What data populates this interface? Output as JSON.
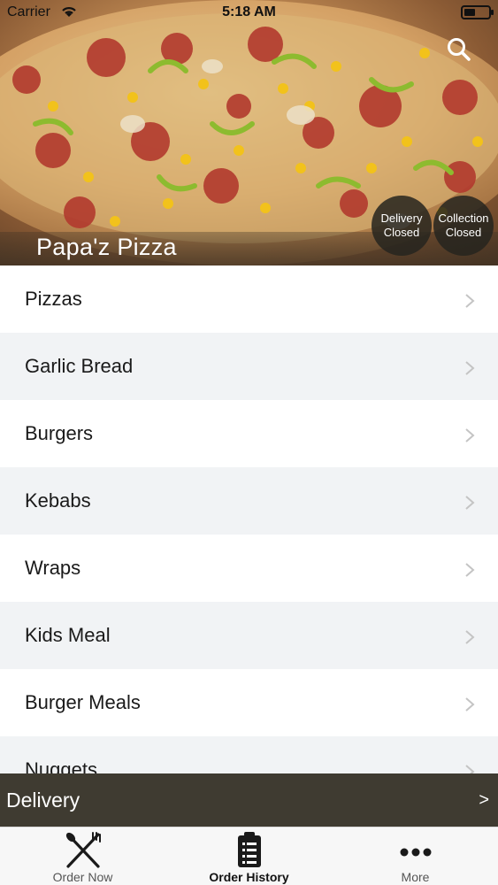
{
  "status_bar": {
    "carrier": "Carrier",
    "time": "5:18 AM"
  },
  "header": {
    "store_name": "Papa'z Pizza",
    "delivery_status": {
      "line1": "Delivery",
      "line2": "Closed"
    },
    "collection_status": {
      "line1": "Collection",
      "line2": "Closed"
    },
    "search_icon": "search-icon"
  },
  "categories": [
    {
      "label": "Pizzas"
    },
    {
      "label": "Garlic Bread"
    },
    {
      "label": "Burgers"
    },
    {
      "label": "Kebabs"
    },
    {
      "label": "Wraps"
    },
    {
      "label": "Kids Meal"
    },
    {
      "label": "Burger Meals"
    },
    {
      "label": "Nuggets"
    }
  ],
  "order_bar": {
    "label": "Delivery",
    "arrow": ">"
  },
  "tab_bar": {
    "tabs": [
      {
        "label": "Order Now",
        "icon": "fork-knife-icon"
      },
      {
        "label": "Order History",
        "icon": "clipboard-list-icon"
      },
      {
        "label": "More",
        "icon": "more-dots-icon"
      }
    ],
    "active": "Order History"
  },
  "colors": {
    "bar_background": "#3f3b31",
    "row_alt": "#f1f3f5",
    "badge_background": "#26241e"
  }
}
